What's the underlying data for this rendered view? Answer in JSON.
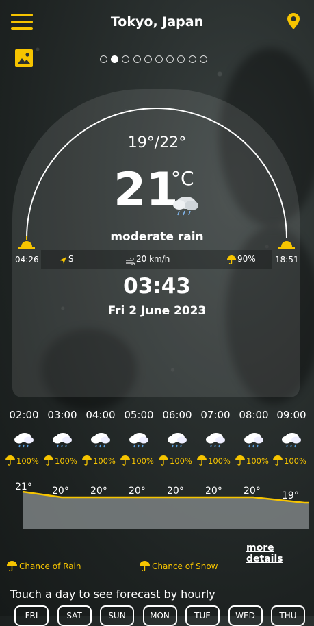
{
  "header": {
    "location": "Tokyo, Japan"
  },
  "pager": {
    "count": 10,
    "active": 1
  },
  "current": {
    "min_max": "19°/22°",
    "temp": "21",
    "unit": "°C",
    "condition": "moderate rain",
    "sunrise": "04:26",
    "sunset": "18:51",
    "wind_dir": "S",
    "wind_speed": "20 km/h",
    "rain_chance": "90%",
    "time": "03:43",
    "date": "Fri 2 June 2023"
  },
  "hourly": [
    {
      "time": "02:00",
      "rain": "100%",
      "temp": "21°"
    },
    {
      "time": "03:00",
      "rain": "100%",
      "temp": "20°"
    },
    {
      "time": "04:00",
      "rain": "100%",
      "temp": "20°"
    },
    {
      "time": "05:00",
      "rain": "100%",
      "temp": "20°"
    },
    {
      "time": "06:00",
      "rain": "100%",
      "temp": "20°"
    },
    {
      "time": "07:00",
      "rain": "100%",
      "temp": "20°"
    },
    {
      "time": "08:00",
      "rain": "100%",
      "temp": "20°"
    },
    {
      "time": "09:00",
      "rain": "100%",
      "temp": "19°"
    }
  ],
  "more_details": "more details",
  "legend": {
    "rain": "Chance of Rain",
    "snow": "Chance of Snow"
  },
  "daily_prompt": "Touch a day to see forecast by hourly",
  "days": [
    "FRI",
    "SAT",
    "SUN",
    "MON",
    "TUE",
    "WED",
    "THU"
  ],
  "colors": {
    "accent": "#f6c400",
    "background": "#232827"
  }
}
